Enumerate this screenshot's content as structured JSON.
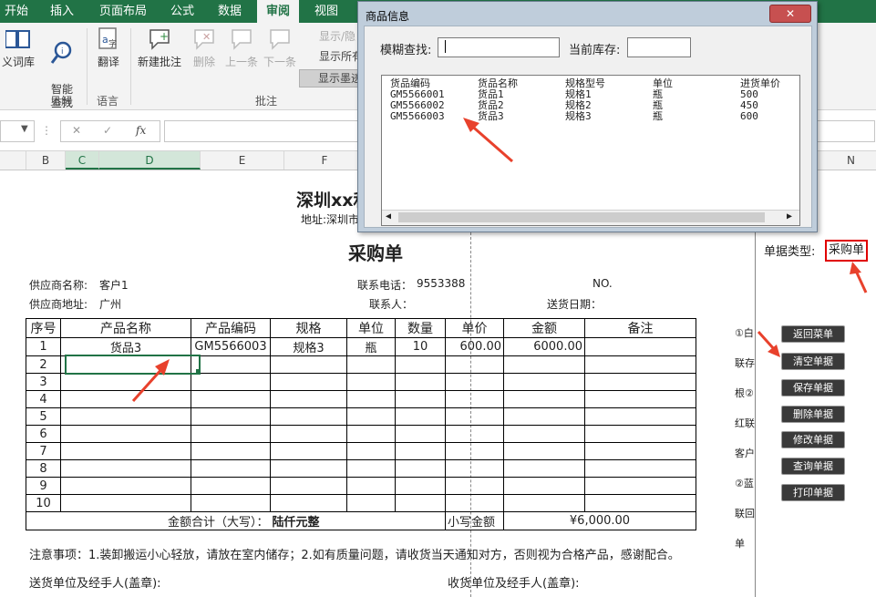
{
  "ribbon": {
    "tabs": [
      "开始",
      "插入",
      "页面布局",
      "公式",
      "数据",
      "审阅",
      "视图"
    ],
    "active_tab": "审阅",
    "buttons": {
      "thesaurus": "义词库",
      "smart_lookup": "智能\n查找",
      "translate": "翻译",
      "new_comment": "新建批注",
      "delete": "删除",
      "previous": "上一条",
      "next": "下一条",
      "show_hide": "显示/隐",
      "show_all": "显示所有",
      "show_ink": "显示墨迹"
    },
    "groups": {
      "insights": "见解",
      "language": "语言",
      "comments": "批注"
    }
  },
  "formula_bar": {
    "fx": "fx",
    "cancel": "✕",
    "confirm": "✓"
  },
  "columns": [
    "B",
    "C",
    "D",
    "E",
    "F",
    "N"
  ],
  "dialog": {
    "title": "商品信息",
    "search_label": "模糊查找:",
    "search_value": "",
    "stock_label": "当前库存:",
    "stock_value": "",
    "list_headers": [
      "货品编码",
      "货品名称",
      "规格型号",
      "单位",
      "进货单价"
    ],
    "list_rows": [
      [
        "GM5566001",
        "货品1",
        "规格1",
        "瓶",
        "500"
      ],
      [
        "GM5566002",
        "货品2",
        "规格2",
        "瓶",
        "450"
      ],
      [
        "GM5566003",
        "货品3",
        "规格3",
        "瓶",
        "600"
      ]
    ]
  },
  "sheet": {
    "company": "深圳xx和",
    "address": "地址:深圳市",
    "title": "采购单",
    "doc_type_label": "单据类型:",
    "doc_type_value": "采购单",
    "supplier_name_label": "供应商名称:",
    "supplier_name": "客户1",
    "supplier_addr_label": "供应商地址:",
    "supplier_addr": "广州",
    "phone_label": "联系电话：",
    "phone": "9553388",
    "contact_label": "联系人：",
    "no_label": "NO.",
    "delivery_label": "送货日期：",
    "headers": [
      "序号",
      "产品名称",
      "产品编码",
      "规格",
      "单位",
      "数量",
      "单价",
      "金额",
      "备注"
    ],
    "rows": [
      [
        "1",
        "货品3",
        "GM5566003",
        "规格3",
        "瓶",
        "10",
        "600.00",
        "6000.00",
        ""
      ],
      [
        "2",
        "",
        "",
        "",
        "",
        "",
        "",
        "",
        ""
      ],
      [
        "3",
        "",
        "",
        "",
        "",
        "",
        "",
        "",
        ""
      ],
      [
        "4",
        "",
        "",
        "",
        "",
        "",
        "",
        "",
        ""
      ],
      [
        "5",
        "",
        "",
        "",
        "",
        "",
        "",
        "",
        ""
      ],
      [
        "6",
        "",
        "",
        "",
        "",
        "",
        "",
        "",
        ""
      ],
      [
        "7",
        "",
        "",
        "",
        "",
        "",
        "",
        "",
        ""
      ],
      [
        "8",
        "",
        "",
        "",
        "",
        "",
        "",
        "",
        ""
      ],
      [
        "9",
        "",
        "",
        "",
        "",
        "",
        "",
        "",
        ""
      ],
      [
        "10",
        "",
        "",
        "",
        "",
        "",
        "",
        "",
        ""
      ]
    ],
    "total_label": "金额合计（大写）：",
    "total_words": "陆仟元整",
    "small_total_label": "小写金额",
    "small_total": "¥6,000.00",
    "side_notes": [
      "①白",
      "联存",
      "根②",
      "红联",
      "客户",
      "②蓝",
      "联回",
      "单"
    ],
    "note": "注意事项：1.装卸搬运小心轻放，请放在室内储存；2.如有质量问题，请收货当天通知对方，否则视为合格产品，感谢配合。",
    "sender_label": "送货单位及经手人(盖章):",
    "receiver_label": "收货单位及经手人(盖章):"
  },
  "side_buttons": [
    "返回菜单",
    "清空单据",
    "保存单据",
    "删除单据",
    "修改单据",
    "查询单据",
    "打印单据"
  ],
  "colors": {
    "excel_green": "#217346",
    "arrow_red": "#e8412c",
    "highlight_red": "#e00000"
  }
}
